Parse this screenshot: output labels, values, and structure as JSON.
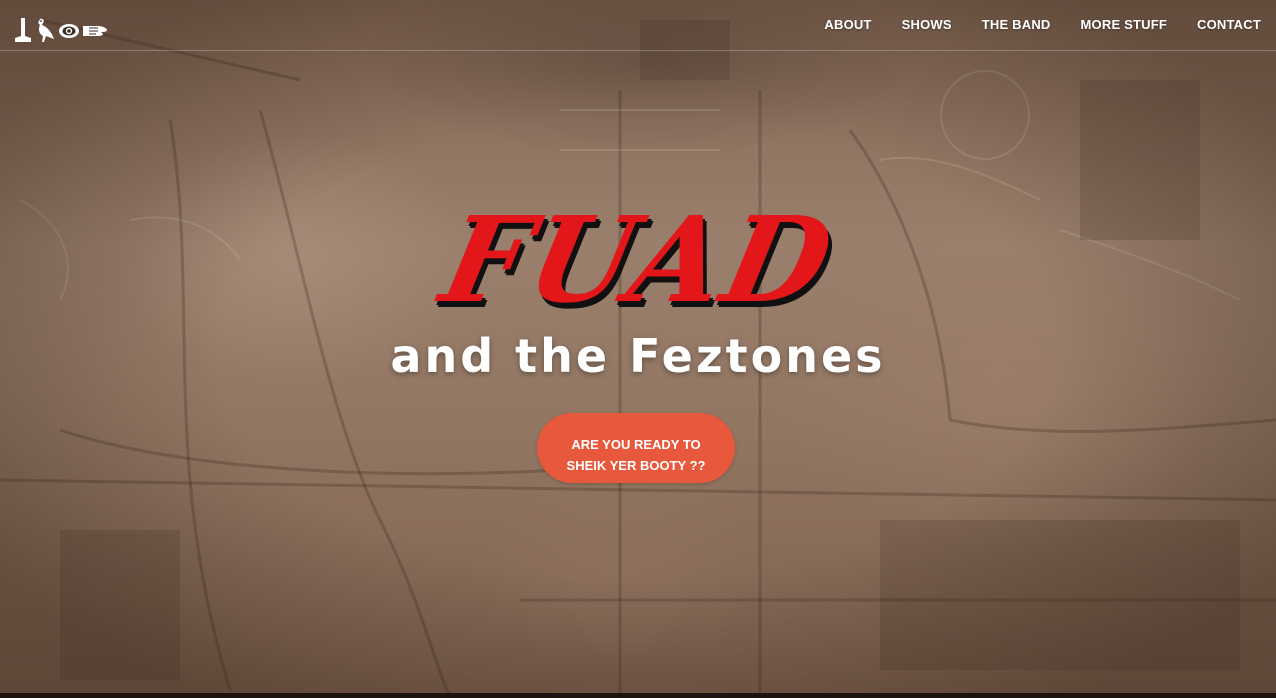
{
  "nav": {
    "links": [
      "ABOUT",
      "SHOWS",
      "THE BAND",
      "MORE STUFF",
      "CONTACT"
    ]
  },
  "hero": {
    "title": "FUAD",
    "subtitle": "and the Feztones",
    "cta_line1": "ARE YOU READY TO",
    "cta_line2": "SHEIK YER BOOTY ??"
  },
  "colors": {
    "title_red": "#e3161a",
    "cta_orange": "#e8583c",
    "nav_text": "#ffffff"
  },
  "icons": {
    "brand": [
      "hieroglyph-leg-icon",
      "hieroglyph-bird-icon",
      "hieroglyph-eye-icon",
      "hieroglyph-hand-icon"
    ]
  }
}
